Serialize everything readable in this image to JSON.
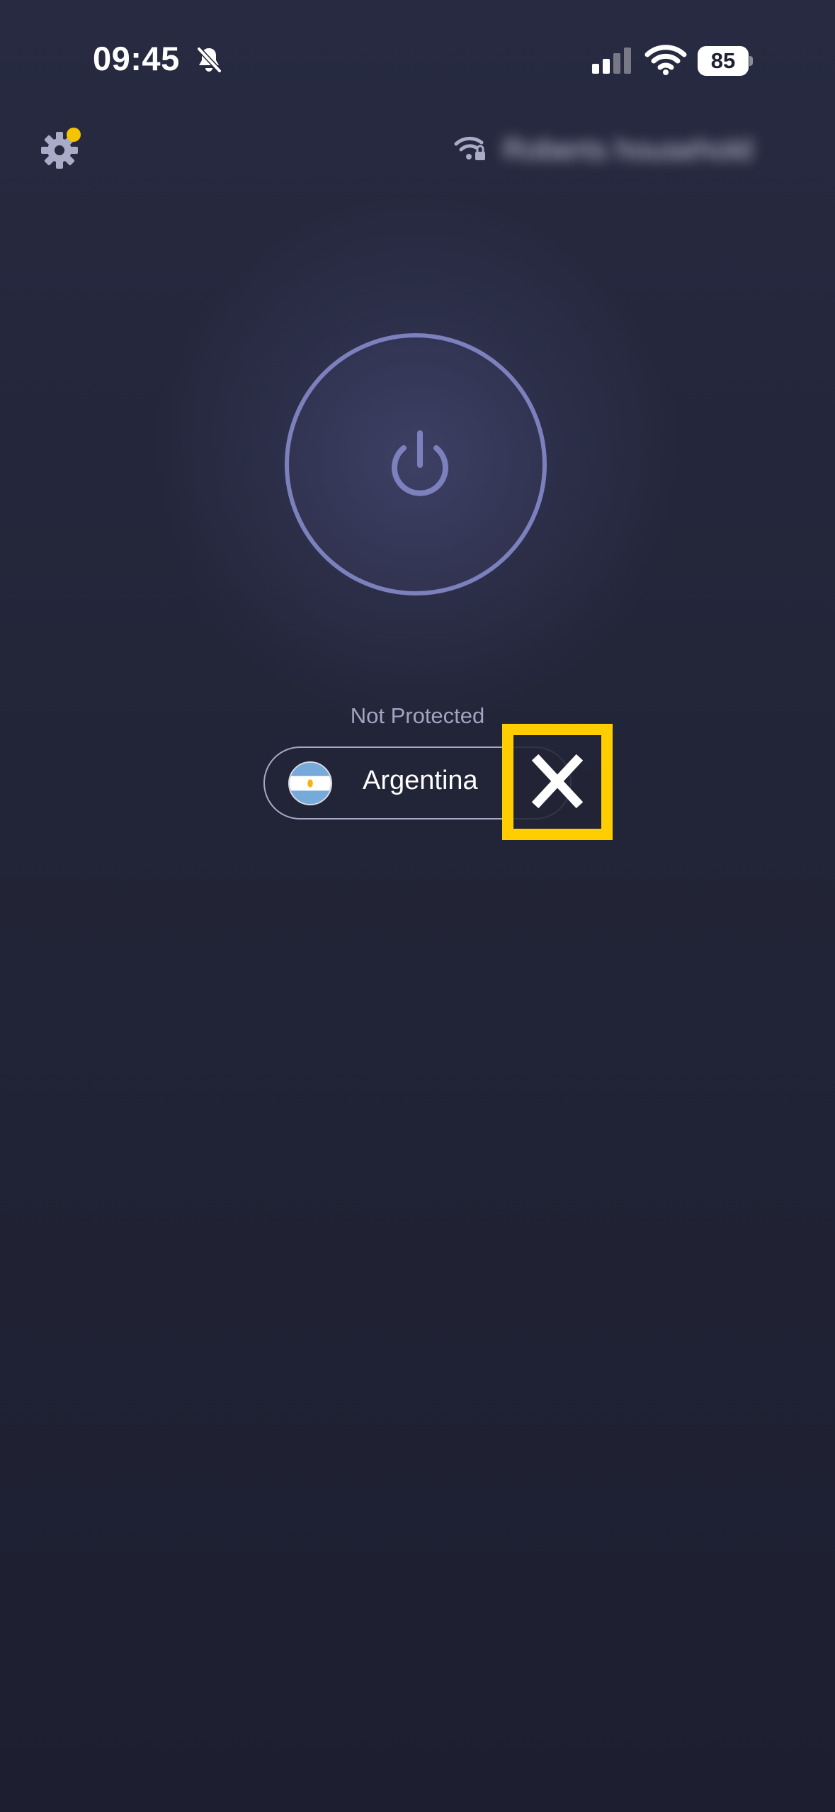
{
  "status_bar": {
    "time": "09:45",
    "silent_icon": "bell-slash-icon",
    "signal_icon": "cellular-signal-icon",
    "wifi_icon": "wifi-icon",
    "battery_level": "85"
  },
  "header": {
    "settings_icon": "gear-icon",
    "network_icon": "secured-wifi-icon",
    "network_name": "Roberts household"
  },
  "vpn": {
    "power_icon": "power-icon",
    "status": "Not Protected",
    "location": {
      "country": "Argentina",
      "flag_icon": "argentina-flag-icon"
    },
    "close_icon": "close-icon"
  },
  "colors": {
    "background": "#222437",
    "accent": "#7c80bd",
    "highlight": "#ffcd00",
    "notification_dot": "#f5c400",
    "text": "#ffffff"
  }
}
